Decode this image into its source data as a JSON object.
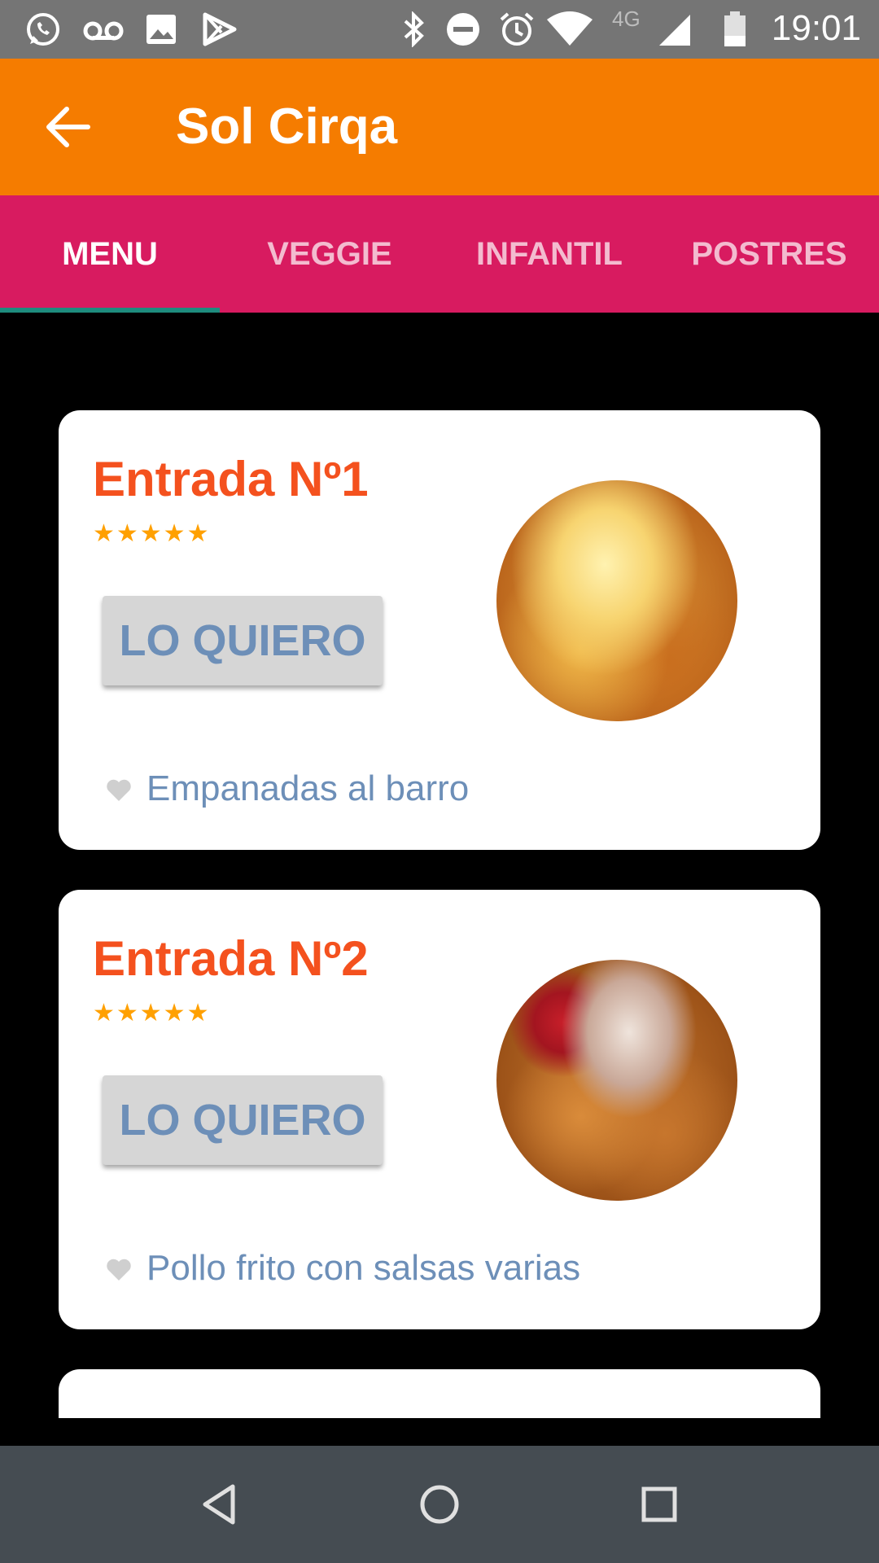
{
  "status_bar": {
    "time": "19:01",
    "network": "4G",
    "icons": [
      "whatsapp-icon",
      "voicemail-icon",
      "image-icon",
      "play-store-icon",
      "bluetooth-icon",
      "do-not-disturb-icon",
      "alarm-icon",
      "wifi-icon",
      "signal-icon",
      "battery-icon"
    ]
  },
  "app_bar": {
    "title": "Sol Cirqa",
    "back_icon": "arrow-back-icon"
  },
  "tabs": [
    {
      "label": "MENU",
      "active": true
    },
    {
      "label": "VEGGIE",
      "active": false
    },
    {
      "label": "INFANTIL",
      "active": false
    },
    {
      "label": "POSTRES",
      "active": false
    }
  ],
  "cards": [
    {
      "title": "Entrada Nº1",
      "rating": 5,
      "rating_text": "★★★★★",
      "button_label": "LO QUIERO",
      "description": "Empanadas al barro",
      "image": "empanadas"
    },
    {
      "title": "Entrada Nº2",
      "rating": 5,
      "rating_text": "★★★★★",
      "button_label": "LO QUIERO",
      "description": "Pollo frito con salsas varias",
      "image": "fried-chicken"
    }
  ],
  "colors": {
    "status_bar": "#757575",
    "app_bar": "#f57c00",
    "tab_bar": "#d81b60",
    "tab_indicator": "#1e8c7e",
    "card_title": "#f4511e",
    "stars": "#ffa000",
    "accent_text": "#6d8fb8",
    "nav_bar": "#454c52"
  },
  "nav_bar": {
    "buttons": [
      "back-triangle-icon",
      "home-circle-icon",
      "recents-square-icon"
    ]
  }
}
